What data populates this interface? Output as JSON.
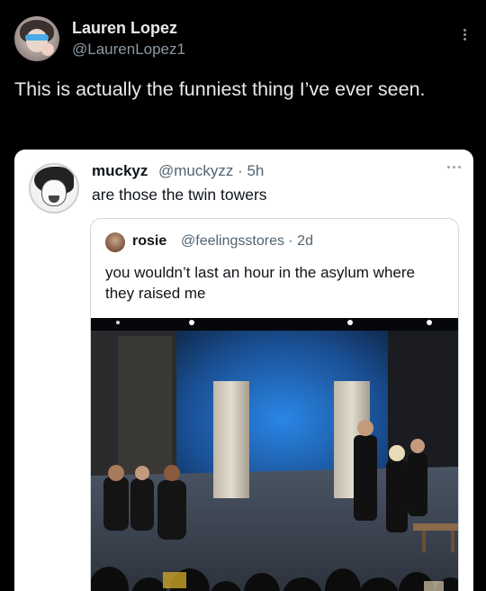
{
  "outer_tweet": {
    "author_name": "Lauren Lopez",
    "author_handle": "@LaurenLopez1",
    "text": "This is actually the funniest thing I’ve ever seen."
  },
  "quoted_tweet": {
    "author_name": "muckyz",
    "meta": "@muckyzz · 5h",
    "text": "are those the twin towers"
  },
  "inner_tweet": {
    "author_name": "rosie",
    "meta": "@feelingsstores · 2d",
    "text": "you wouldn’t last an hour in the asylum where they raised me"
  },
  "icons": {
    "outer_more": "more-vertical-icon",
    "card_more": "more-horizontal-icon"
  },
  "colors": {
    "background": "#000000",
    "card": "#ffffff",
    "secondary_text": "#8b98a5",
    "stage_light": "#1f6fc4"
  }
}
